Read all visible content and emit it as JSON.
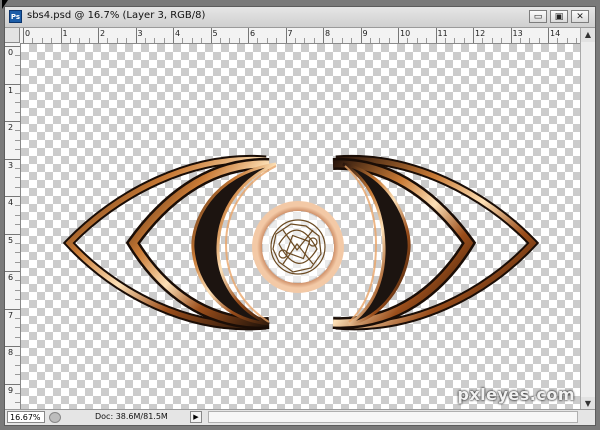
{
  "window": {
    "app_badge": "Ps",
    "title": "sbs4.psd @ 16.7% (Layer 3, RGB/8)",
    "buttons": {
      "minimize": "▭",
      "restore": "▣",
      "close": "✕"
    }
  },
  "rulers": {
    "horizontal_labels": [
      "0",
      "1",
      "2",
      "3",
      "4",
      "5",
      "6",
      "7",
      "8",
      "9",
      "10",
      "11",
      "12",
      "13",
      "14"
    ],
    "vertical_labels": [
      "0",
      "1",
      "2",
      "3",
      "4",
      "5",
      "6",
      "7",
      "8",
      "9"
    ]
  },
  "statusbar": {
    "zoom": "16.67%",
    "doc_info": "Doc: 38.6M/81.5M",
    "arrow": "▶"
  },
  "watermark": "pxleyes.com",
  "colors": {
    "copper_light": "#f7d6ac",
    "copper_mid": "#b8662a",
    "copper_dark": "#2d1a10",
    "checker": "#cccccc"
  }
}
